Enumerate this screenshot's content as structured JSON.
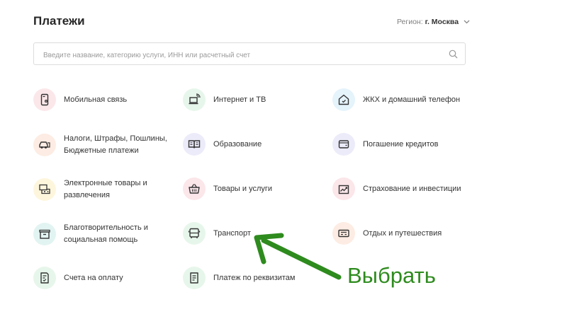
{
  "header": {
    "title": "Платежи",
    "region_label": "Регион:",
    "region_value": "г. Москва"
  },
  "search": {
    "placeholder": "Введите название, категорию услуги, ИНН или расчетный счет"
  },
  "categories": [
    {
      "line1": "Мобильная связь",
      "line2": "",
      "icon": "mobile-phone-icon"
    },
    {
      "line1": "Интернет и ТВ",
      "line2": "",
      "icon": "laptop-wifi-icon"
    },
    {
      "line1": "ЖКХ и домашний телефон",
      "line2": "",
      "icon": "house-icon"
    },
    {
      "line1": "Налоги, Штрафы, Пошлины,",
      "line2": "Бюджетные платежи",
      "icon": "car-icon"
    },
    {
      "line1": "Образование",
      "line2": "",
      "icon": "book-icon"
    },
    {
      "line1": "Погашение кредитов",
      "line2": "",
      "icon": "wallet-icon"
    },
    {
      "line1": "Электронные товары и",
      "line2": "развлечения",
      "icon": "gamepad-icon"
    },
    {
      "line1": "Товары и услуги",
      "line2": "",
      "icon": "basket-icon"
    },
    {
      "line1": "Страхование и инвестиции",
      "line2": "",
      "icon": "chart-icon"
    },
    {
      "line1": "Благотворительность и",
      "line2": "социальная помощь",
      "icon": "charity-box-icon"
    },
    {
      "line1": "Транспорт",
      "line2": "",
      "icon": "bus-icon"
    },
    {
      "line1": "Отдых и путешествия",
      "line2": "",
      "icon": "ticket-icon"
    },
    {
      "line1": "Счета на оплату",
      "line2": "",
      "icon": "invoice-icon"
    },
    {
      "line1": "Платеж по реквизитам",
      "line2": "",
      "icon": "document-icon"
    }
  ],
  "annotation": {
    "text": "Выбрать",
    "color": "#2e8b1e"
  },
  "colors": {
    "icon_stroke": "#333333",
    "annotation_green": "#2e8b1e"
  }
}
